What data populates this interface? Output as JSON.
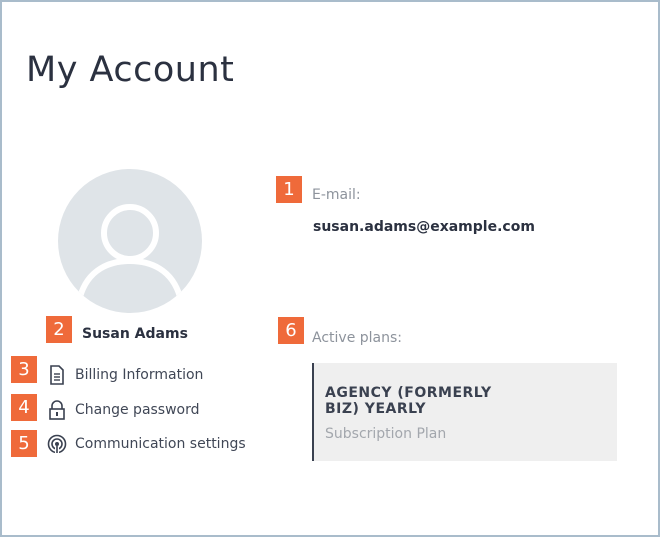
{
  "page": {
    "title": "My Account"
  },
  "profile": {
    "name": "Susan Adams"
  },
  "markers": [
    "1",
    "2",
    "3",
    "4",
    "5",
    "6"
  ],
  "menu": {
    "items": [
      {
        "label": "Billing Information",
        "icon": "document-icon"
      },
      {
        "label": "Change password",
        "icon": "lock-icon"
      },
      {
        "label": "Communication settings",
        "icon": "broadcast-icon"
      }
    ]
  },
  "account": {
    "email_label": "E-mail:",
    "email": "susan.adams@example.com",
    "plans_label": "Active plans:",
    "plans": [
      {
        "name": "AGENCY (FORMERLY BIZ) YEARLY",
        "type": "Subscription Plan"
      }
    ]
  },
  "colors": {
    "marker": "#ef6a3a",
    "frame": "#a9bccb",
    "card_bg": "#efefef",
    "avatar_bg": "#dfe4e8"
  }
}
